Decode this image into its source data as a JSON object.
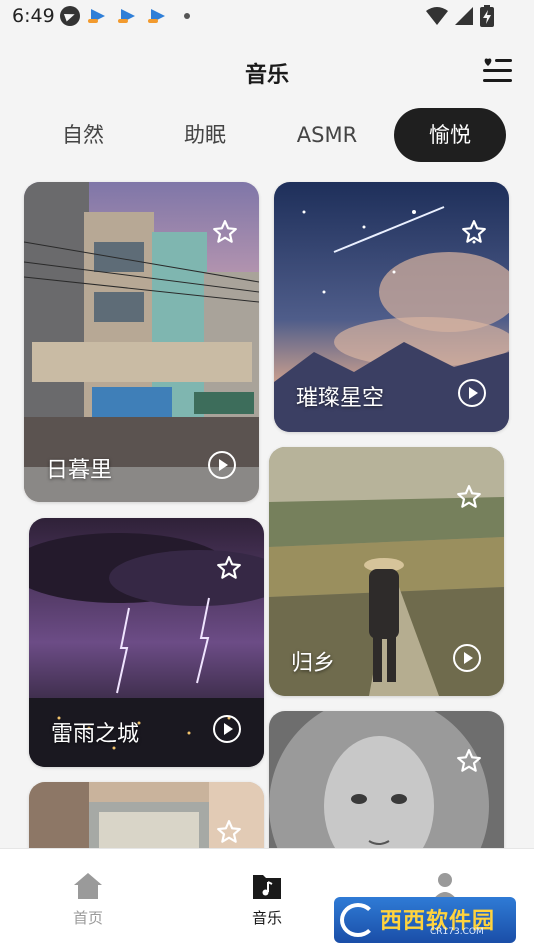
{
  "status_bar": {
    "time": "6:49",
    "icons": [
      "telegram-icon",
      "app-arrow-icon",
      "app-arrow-icon",
      "app-arrow-icon",
      "notification-dot-icon",
      "wifi-icon",
      "signal-icon",
      "battery-charging-icon"
    ]
  },
  "header": {
    "title": "音乐",
    "right_icon": "playlist-favorite-icon"
  },
  "tabs": [
    {
      "label": "自然",
      "active": false
    },
    {
      "label": "助眠",
      "active": false
    },
    {
      "label": "ASMR",
      "active": false
    },
    {
      "label": "愉悦",
      "active": true
    }
  ],
  "cards": [
    {
      "title": "日暮里",
      "scene": "city-street-dusk",
      "favorite": false
    },
    {
      "title": "璀璨星空",
      "scene": "starry-sky",
      "favorite": false
    },
    {
      "title": "归乡",
      "scene": "countryside-path",
      "favorite": false
    },
    {
      "title": "雷雨之城",
      "scene": "thunderstorm-city",
      "favorite": false
    },
    {
      "title": "",
      "scene": "window-room",
      "favorite": false
    },
    {
      "title": "",
      "scene": "girl-portrait",
      "favorite": false
    }
  ],
  "bottom_nav": [
    {
      "label": "首页",
      "icon": "home-icon",
      "active": false
    },
    {
      "label": "音乐",
      "icon": "music-note-icon",
      "active": true
    },
    {
      "label": "",
      "icon": "profile-icon",
      "active": false
    }
  ],
  "watermark": {
    "text": "西西软件园",
    "sub": "CR173.COM"
  },
  "colors": {
    "background": "#f4f4f4",
    "active_tab": "#1f1f1f",
    "active_nav": "#1a1a1a",
    "inactive_nav": "#9a9a9a"
  }
}
